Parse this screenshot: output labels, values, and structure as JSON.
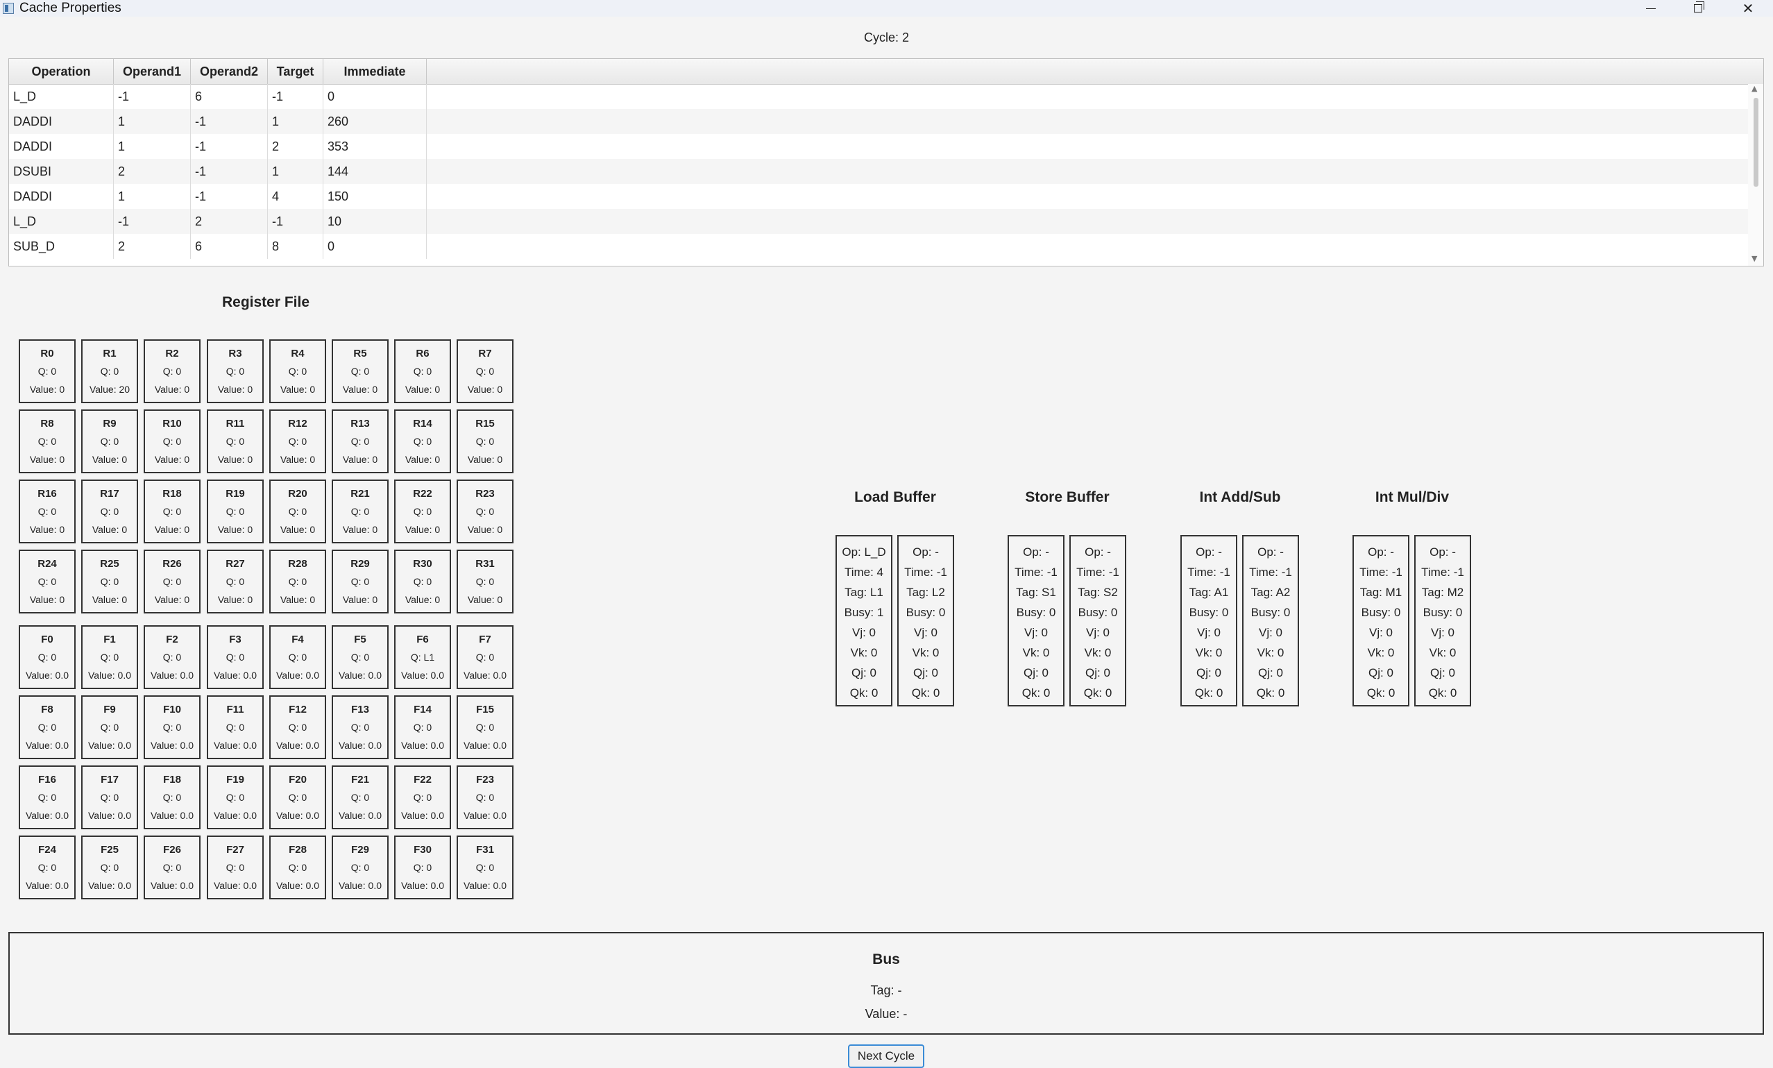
{
  "window": {
    "title": "Cache Properties",
    "minimize_icon": "minimize-icon",
    "maximize_icon": "restore-icon",
    "close_icon": "close-icon"
  },
  "cycle_label": "Cycle: 2",
  "instruction_table": {
    "headers": [
      "Operation",
      "Operand1",
      "Operand2",
      "Target",
      "Immediate"
    ],
    "rows": [
      [
        "L_D",
        "-1",
        "6",
        "-1",
        "0"
      ],
      [
        "DADDI",
        "1",
        "-1",
        "1",
        "260"
      ],
      [
        "DADDI",
        "1",
        "-1",
        "2",
        "353"
      ],
      [
        "DSUBI",
        "2",
        "-1",
        "1",
        "144"
      ],
      [
        "DADDI",
        "1",
        "-1",
        "4",
        "150"
      ],
      [
        "L_D",
        "-1",
        "2",
        "-1",
        "10"
      ],
      [
        "SUB_D",
        "2",
        "6",
        "8",
        "0"
      ]
    ]
  },
  "register_file": {
    "title": "Register File",
    "int_registers": [
      {
        "name": "R0",
        "q": "Q: 0",
        "value": "Value: 0"
      },
      {
        "name": "R1",
        "q": "Q: 0",
        "value": "Value: 20"
      },
      {
        "name": "R2",
        "q": "Q: 0",
        "value": "Value: 0"
      },
      {
        "name": "R3",
        "q": "Q: 0",
        "value": "Value: 0"
      },
      {
        "name": "R4",
        "q": "Q: 0",
        "value": "Value: 0"
      },
      {
        "name": "R5",
        "q": "Q: 0",
        "value": "Value: 0"
      },
      {
        "name": "R6",
        "q": "Q: 0",
        "value": "Value: 0"
      },
      {
        "name": "R7",
        "q": "Q: 0",
        "value": "Value: 0"
      },
      {
        "name": "R8",
        "q": "Q: 0",
        "value": "Value: 0"
      },
      {
        "name": "R9",
        "q": "Q: 0",
        "value": "Value: 0"
      },
      {
        "name": "R10",
        "q": "Q: 0",
        "value": "Value: 0"
      },
      {
        "name": "R11",
        "q": "Q: 0",
        "value": "Value: 0"
      },
      {
        "name": "R12",
        "q": "Q: 0",
        "value": "Value: 0"
      },
      {
        "name": "R13",
        "q": "Q: 0",
        "value": "Value: 0"
      },
      {
        "name": "R14",
        "q": "Q: 0",
        "value": "Value: 0"
      },
      {
        "name": "R15",
        "q": "Q: 0",
        "value": "Value: 0"
      },
      {
        "name": "R16",
        "q": "Q: 0",
        "value": "Value: 0"
      },
      {
        "name": "R17",
        "q": "Q: 0",
        "value": "Value: 0"
      },
      {
        "name": "R18",
        "q": "Q: 0",
        "value": "Value: 0"
      },
      {
        "name": "R19",
        "q": "Q: 0",
        "value": "Value: 0"
      },
      {
        "name": "R20",
        "q": "Q: 0",
        "value": "Value: 0"
      },
      {
        "name": "R21",
        "q": "Q: 0",
        "value": "Value: 0"
      },
      {
        "name": "R22",
        "q": "Q: 0",
        "value": "Value: 0"
      },
      {
        "name": "R23",
        "q": "Q: 0",
        "value": "Value: 0"
      },
      {
        "name": "R24",
        "q": "Q: 0",
        "value": "Value: 0"
      },
      {
        "name": "R25",
        "q": "Q: 0",
        "value": "Value: 0"
      },
      {
        "name": "R26",
        "q": "Q: 0",
        "value": "Value: 0"
      },
      {
        "name": "R27",
        "q": "Q: 0",
        "value": "Value: 0"
      },
      {
        "name": "R28",
        "q": "Q: 0",
        "value": "Value: 0"
      },
      {
        "name": "R29",
        "q": "Q: 0",
        "value": "Value: 0"
      },
      {
        "name": "R30",
        "q": "Q: 0",
        "value": "Value: 0"
      },
      {
        "name": "R31",
        "q": "Q: 0",
        "value": "Value: 0"
      }
    ],
    "fp_registers": [
      {
        "name": "F0",
        "q": "Q: 0",
        "value": "Value: 0.0"
      },
      {
        "name": "F1",
        "q": "Q: 0",
        "value": "Value: 0.0"
      },
      {
        "name": "F2",
        "q": "Q: 0",
        "value": "Value: 0.0"
      },
      {
        "name": "F3",
        "q": "Q: 0",
        "value": "Value: 0.0"
      },
      {
        "name": "F4",
        "q": "Q: 0",
        "value": "Value: 0.0"
      },
      {
        "name": "F5",
        "q": "Q: 0",
        "value": "Value: 0.0"
      },
      {
        "name": "F6",
        "q": "Q: L1",
        "value": "Value: 0.0"
      },
      {
        "name": "F7",
        "q": "Q: 0",
        "value": "Value: 0.0"
      },
      {
        "name": "F8",
        "q": "Q: 0",
        "value": "Value: 0.0"
      },
      {
        "name": "F9",
        "q": "Q: 0",
        "value": "Value: 0.0"
      },
      {
        "name": "F10",
        "q": "Q: 0",
        "value": "Value: 0.0"
      },
      {
        "name": "F11",
        "q": "Q: 0",
        "value": "Value: 0.0"
      },
      {
        "name": "F12",
        "q": "Q: 0",
        "value": "Value: 0.0"
      },
      {
        "name": "F13",
        "q": "Q: 0",
        "value": "Value: 0.0"
      },
      {
        "name": "F14",
        "q": "Q: 0",
        "value": "Value: 0.0"
      },
      {
        "name": "F15",
        "q": "Q: 0",
        "value": "Value: 0.0"
      },
      {
        "name": "F16",
        "q": "Q: 0",
        "value": "Value: 0.0"
      },
      {
        "name": "F17",
        "q": "Q: 0",
        "value": "Value: 0.0"
      },
      {
        "name": "F18",
        "q": "Q: 0",
        "value": "Value: 0.0"
      },
      {
        "name": "F19",
        "q": "Q: 0",
        "value": "Value: 0.0"
      },
      {
        "name": "F20",
        "q": "Q: 0",
        "value": "Value: 0.0"
      },
      {
        "name": "F21",
        "q": "Q: 0",
        "value": "Value: 0.0"
      },
      {
        "name": "F22",
        "q": "Q: 0",
        "value": "Value: 0.0"
      },
      {
        "name": "F23",
        "q": "Q: 0",
        "value": "Value: 0.0"
      },
      {
        "name": "F24",
        "q": "Q: 0",
        "value": "Value: 0.0"
      },
      {
        "name": "F25",
        "q": "Q: 0",
        "value": "Value: 0.0"
      },
      {
        "name": "F26",
        "q": "Q: 0",
        "value": "Value: 0.0"
      },
      {
        "name": "F27",
        "q": "Q: 0",
        "value": "Value: 0.0"
      },
      {
        "name": "F28",
        "q": "Q: 0",
        "value": "Value: 0.0"
      },
      {
        "name": "F29",
        "q": "Q: 0",
        "value": "Value: 0.0"
      },
      {
        "name": "F30",
        "q": "Q: 0",
        "value": "Value: 0.0"
      },
      {
        "name": "F31",
        "q": "Q: 0",
        "value": "Value: 0.0"
      }
    ]
  },
  "stations": [
    {
      "title": "Load Buffer",
      "entries": [
        [
          "Op: L_D",
          "Time: 4",
          "Tag: L1",
          "Busy: 1",
          "Vj: 0",
          "Vk: 0",
          "Qj: 0",
          "Qk: 0"
        ],
        [
          "Op: -",
          "Time: -1",
          "Tag: L2",
          "Busy: 0",
          "Vj: 0",
          "Vk: 0",
          "Qj: 0",
          "Qk: 0"
        ]
      ]
    },
    {
      "title": "Store Buffer",
      "entries": [
        [
          "Op: -",
          "Time: -1",
          "Tag: S1",
          "Busy: 0",
          "Vj: 0",
          "Vk: 0",
          "Qj: 0",
          "Qk: 0"
        ],
        [
          "Op: -",
          "Time: -1",
          "Tag: S2",
          "Busy: 0",
          "Vj: 0",
          "Vk: 0",
          "Qj: 0",
          "Qk: 0"
        ]
      ]
    },
    {
      "title": "Int Add/Sub",
      "entries": [
        [
          "Op: -",
          "Time: -1",
          "Tag: A1",
          "Busy: 0",
          "Vj: 0",
          "Vk: 0",
          "Qj: 0",
          "Qk: 0"
        ],
        [
          "Op: -",
          "Time: -1",
          "Tag: A2",
          "Busy: 0",
          "Vj: 0",
          "Vk: 0",
          "Qj: 0",
          "Qk: 0"
        ]
      ]
    },
    {
      "title": "Int Mul/Div",
      "entries": [
        [
          "Op: -",
          "Time: -1",
          "Tag: M1",
          "Busy: 0",
          "Vj: 0",
          "Vk: 0",
          "Qj: 0",
          "Qk: 0"
        ],
        [
          "Op: -",
          "Time: -1",
          "Tag: M2",
          "Busy: 0",
          "Vj: 0",
          "Vk: 0",
          "Qj: 0",
          "Qk: 0"
        ]
      ]
    }
  ],
  "bus": {
    "title": "Bus",
    "tag": "Tag: -",
    "value": "Value: -"
  },
  "next_button_label": "Next Cycle"
}
